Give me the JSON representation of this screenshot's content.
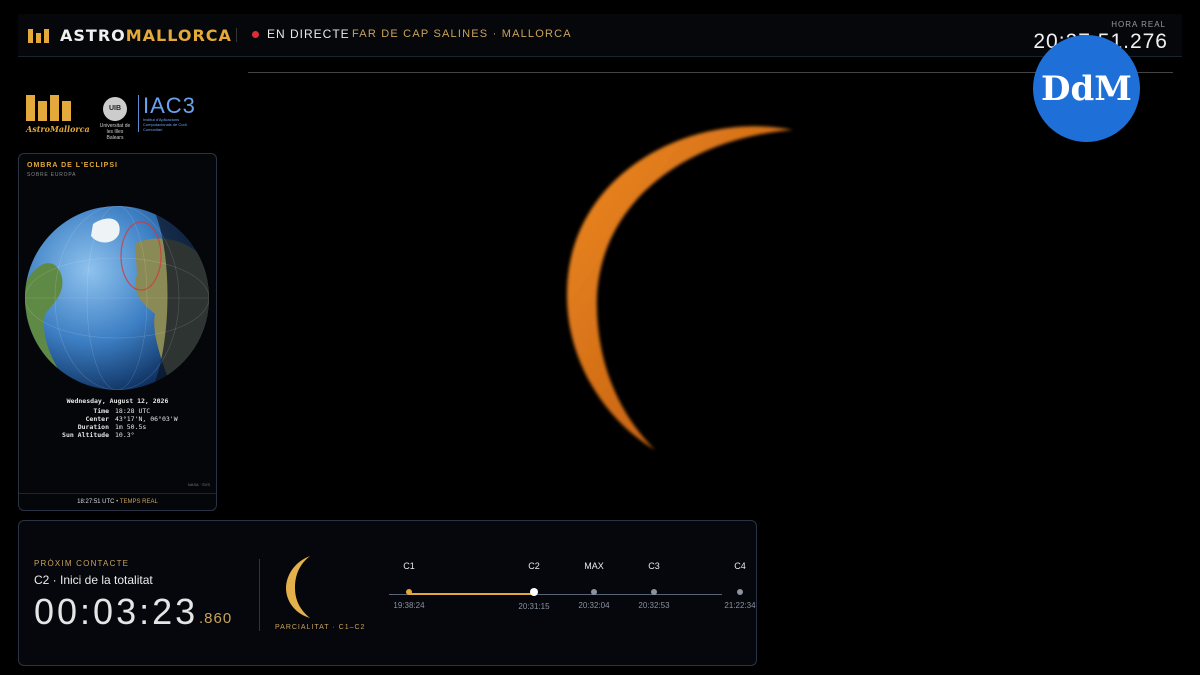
{
  "header": {
    "brand_prefix": "ASTRO",
    "brand_suffix": "MALLORCA",
    "live_label": "EN DIRECTE",
    "location": "FAR DE CAP SALINES · MALLORCA",
    "clock_label": "HORA REAL",
    "clock_value": "20:27:51.276"
  },
  "badge": {
    "text": "DdM",
    "color": "#1f6fd8"
  },
  "logos": {
    "astromallorca_text": "AstroMallorca",
    "uib_seal": "UIB",
    "uib_text": "Universitat de les Illes Balears",
    "iac3_name": "IAC3",
    "iac3_text": "Institut d'Aplicacions Computacionals de Codi Comunitari"
  },
  "eclipse_panel": {
    "title": "OMBRA DE L'ECLIPSI",
    "subtitle": "SOBRE EUROPA",
    "date": "Wednesday, August 12, 2026",
    "rows": [
      {
        "k": "Time",
        "v": "18:28 UTC"
      },
      {
        "k": "Center",
        "v": "43°17'N, 06°03'W"
      },
      {
        "k": "Duration",
        "v": "1m 50.5s"
      },
      {
        "k": "Sun Altitude",
        "v": "10.3°"
      }
    ],
    "credit": "NASA · SVS",
    "footer_time": "18:27:51 UTC",
    "footer_sep": "•",
    "footer_mode": "TEMPS REAL"
  },
  "countdown": {
    "label": "PRÒXIM CONTACTE",
    "event": "C2 · Inici de la totalitat",
    "time": "00:03:23",
    "ms": ".860",
    "phase": "PARCIALITAT · C1–C2"
  },
  "timeline": {
    "progress_fraction": 0.38,
    "contacts": [
      {
        "name": "C1",
        "time": "19:38:24",
        "state": "active"
      },
      {
        "name": "C2",
        "time": "20:31:15",
        "state": "current"
      },
      {
        "name": "MAX",
        "time": "20:32:04",
        "state": "pending"
      },
      {
        "name": "C3",
        "time": "20:32:53",
        "state": "pending"
      },
      {
        "name": "C4",
        "time": "21:22:34",
        "state": "pending"
      }
    ]
  },
  "colors": {
    "accent": "#e3a93a",
    "live": "#e02c3a",
    "sun": "#e07a18"
  }
}
